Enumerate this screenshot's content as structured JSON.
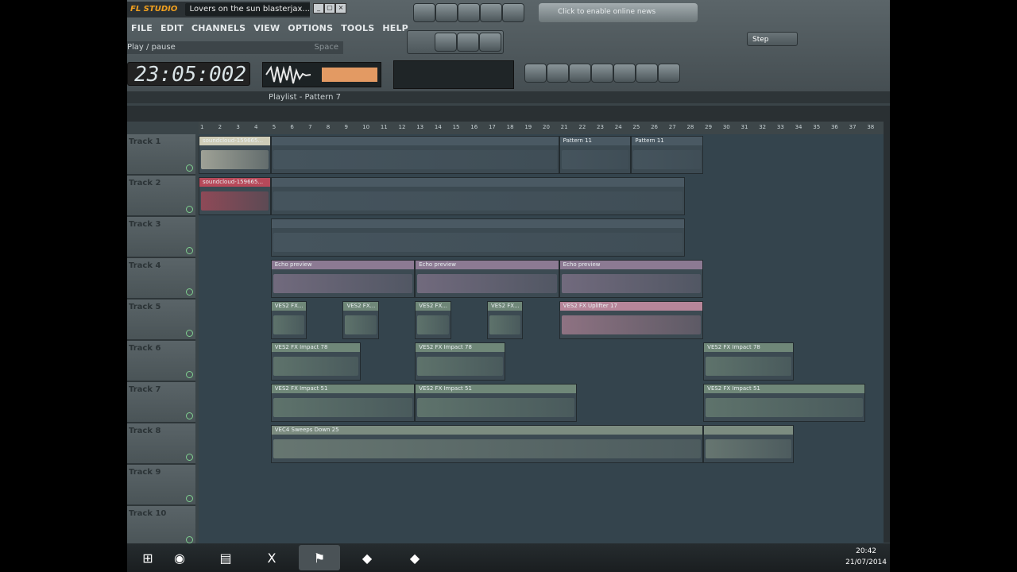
{
  "app": {
    "logo": "FL STUDIO",
    "window_title": "Lovers on the sun blasterjax...",
    "window_buttons": [
      "_",
      "▢",
      "×"
    ]
  },
  "menu": [
    "FILE",
    "EDIT",
    "CHANNELS",
    "VIEW",
    "OPTIONS",
    "TOOLS",
    "HELP"
  ],
  "hint": {
    "text": "Play / pause",
    "key": "Space"
  },
  "clock": "23:05:002",
  "online": {
    "text": "Click to enable online news"
  },
  "snap": {
    "value": "Step"
  },
  "playlist": {
    "title": "Playlist - Pattern 7"
  },
  "timeline": [
    "1",
    "2",
    "3",
    "4",
    "5",
    "6",
    "7",
    "8",
    "9",
    "10",
    "11",
    "12",
    "13",
    "14",
    "15",
    "16",
    "17",
    "18",
    "19",
    "20",
    "21",
    "22",
    "23",
    "24",
    "25",
    "26",
    "27",
    "28",
    "29",
    "30",
    "31",
    "32",
    "33",
    "34",
    "35",
    "36",
    "37",
    "38"
  ],
  "tracks": [
    {
      "label": "Track 1",
      "clips": [
        {
          "name": "soundcloud-159665...",
          "start": 1,
          "len": 4,
          "color": "#cfcdb8"
        },
        {
          "name": "",
          "start": 5,
          "len": 16,
          "color": "#4a5963"
        },
        {
          "name": "Pattern 11",
          "start": 21,
          "len": 4,
          "color": "#4a5963"
        },
        {
          "name": "Pattern 11",
          "start": 25,
          "len": 4,
          "color": "#4a5963"
        }
      ]
    },
    {
      "label": "Track 2",
      "clips": [
        {
          "name": "soundcloud-159665...",
          "start": 1,
          "len": 4,
          "color": "#b7495a"
        },
        {
          "name": "",
          "start": 5,
          "len": 23,
          "color": "#4a5963"
        }
      ]
    },
    {
      "label": "Track 3",
      "clips": [
        {
          "name": "",
          "start": 5,
          "len": 23,
          "color": "#4a5963"
        }
      ]
    },
    {
      "label": "Track 4",
      "clips": [
        {
          "name": "Echo preview",
          "start": 5,
          "len": 8,
          "color": "#8c7a93"
        },
        {
          "name": "Echo preview",
          "start": 13,
          "len": 8,
          "color": "#8c7a93"
        },
        {
          "name": "Echo preview",
          "start": 21,
          "len": 8,
          "color": "#8c7a93"
        }
      ]
    },
    {
      "label": "Track 5",
      "clips": [
        {
          "name": "VES2 FX...",
          "start": 5,
          "len": 2,
          "color": "#6f8778"
        },
        {
          "name": "VES2 FX...",
          "start": 9,
          "len": 2,
          "color": "#6f8778"
        },
        {
          "name": "VES2 FX...",
          "start": 13,
          "len": 2,
          "color": "#6f8778"
        },
        {
          "name": "VES2 FX...",
          "start": 17,
          "len": 2,
          "color": "#6f8778"
        },
        {
          "name": "VES2 FX Uplifter 17",
          "start": 21,
          "len": 8,
          "color": "#b7869a"
        }
      ]
    },
    {
      "label": "Track 6",
      "clips": [
        {
          "name": "VES2 FX Impact 78",
          "start": 5,
          "len": 5,
          "color": "#6f8778"
        },
        {
          "name": "VES2 FX Impact 78",
          "start": 13,
          "len": 5,
          "color": "#6f8778"
        },
        {
          "name": "VES2 FX Impact 78",
          "start": 29,
          "len": 5,
          "color": "#6f8778"
        }
      ]
    },
    {
      "label": "Track 7",
      "clips": [
        {
          "name": "VES2 FX Impact 51",
          "start": 5,
          "len": 8,
          "color": "#6f8778"
        },
        {
          "name": "VES2 FX Impact 51",
          "start": 13,
          "len": 9,
          "color": "#6f8778"
        },
        {
          "name": "VES2 FX Impact 51",
          "start": 29,
          "len": 9,
          "color": "#6f8778"
        }
      ]
    },
    {
      "label": "Track 8",
      "clips": [
        {
          "name": "VEC4 Sweeps Down 25",
          "start": 5,
          "len": 24,
          "color": "#7c8c80"
        },
        {
          "name": "",
          "start": 29,
          "len": 5,
          "color": "#7c8c80"
        }
      ]
    },
    {
      "label": "Track 9",
      "clips": []
    },
    {
      "label": "Track 10",
      "clips": []
    }
  ],
  "taskbar": {
    "apps": [
      "windows-start",
      "chrome",
      "file-explorer",
      "excel",
      "fl-studio",
      "fl-app-2",
      "fl-app-3"
    ],
    "time": "20:42",
    "date": "21/07/2014"
  }
}
